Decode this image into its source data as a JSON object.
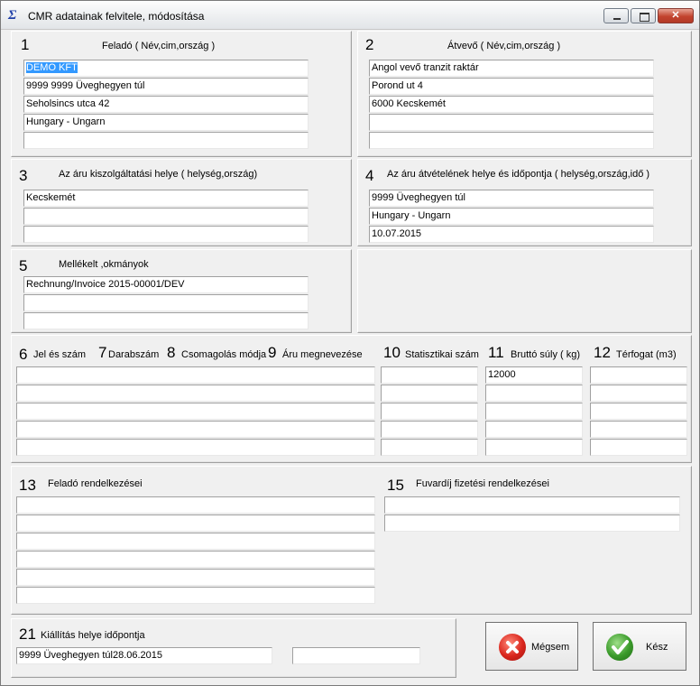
{
  "window": {
    "title": "CMR adatainak felvitele, módosítása",
    "icon_glyph": "Σ"
  },
  "sections": {
    "s1": {
      "num": "1",
      "label": "Feladó ( Név,cim,ország )",
      "fields": [
        "DEMO KFT",
        "9999 9999 Üveghegyen túl",
        "Seholsincs utca 42",
        "Hungary - Ungarn",
        ""
      ]
    },
    "s2": {
      "num": "2",
      "label": "Átvevő ( Név,cim,ország )",
      "fields": [
        "Angol vevő tranzit raktár",
        "Porond ut 4",
        " 6000 Kecskemét",
        "",
        ""
      ]
    },
    "s3": {
      "num": "3",
      "label": "Az áru kiszolgáltatási helye ( helység,ország)",
      "fields": [
        "Kecskemét",
        "",
        ""
      ]
    },
    "s4": {
      "num": "4",
      "label": "Az áru átvételének helye és időpontja  ( helység,ország,idő )",
      "fields": [
        "9999 Üveghegyen túl",
        "Hungary - Ungarn",
        "10.07.2015"
      ]
    },
    "s5": {
      "num": "5",
      "label": "Mellékelt ,okmányok",
      "fields": [
        "Rechnung/Invoice 2015-00001/DEV",
        "",
        ""
      ]
    },
    "goods": {
      "cols": [
        {
          "num": "6",
          "label": "Jel és szám"
        },
        {
          "num": "7",
          "label": "Darabszám"
        },
        {
          "num": "8",
          "label": "Csomagolás módja"
        },
        {
          "num": "9",
          "label": "Áru megnevezése"
        },
        {
          "num": "10",
          "label": "Statisztikai szám"
        },
        {
          "num": "11",
          "label": "Bruttó súly ( kg)"
        },
        {
          "num": "12",
          "label": "Térfogat (m3)"
        }
      ],
      "desc_rows": [
        "",
        "",
        "",
        "",
        ""
      ],
      "stat_rows": [
        "",
        "",
        "",
        "",
        ""
      ],
      "weight_rows": [
        "12000",
        "",
        "",
        "",
        ""
      ],
      "volume_rows": [
        "",
        "",
        "",
        "",
        ""
      ]
    },
    "s13": {
      "num": "13",
      "label": "Feladó rendelkezései",
      "fields": [
        "",
        "",
        "",
        "",
        "",
        ""
      ]
    },
    "s15": {
      "num": "15",
      "label": "Fuvardíj fizetési rendelkezései",
      "fields": [
        "",
        ""
      ]
    },
    "s21": {
      "num": "21",
      "label": "Kiállítás helye időpontja",
      "place_date": "9999 Üveghegyen túl28.06.2015",
      "extra": ""
    }
  },
  "buttons": {
    "cancel": "Mégsem",
    "ok": "Kész"
  },
  "colors": {
    "cancel_icon": "#d9251c",
    "ok_icon": "#3a9a2a",
    "selection": "#3399ff"
  }
}
